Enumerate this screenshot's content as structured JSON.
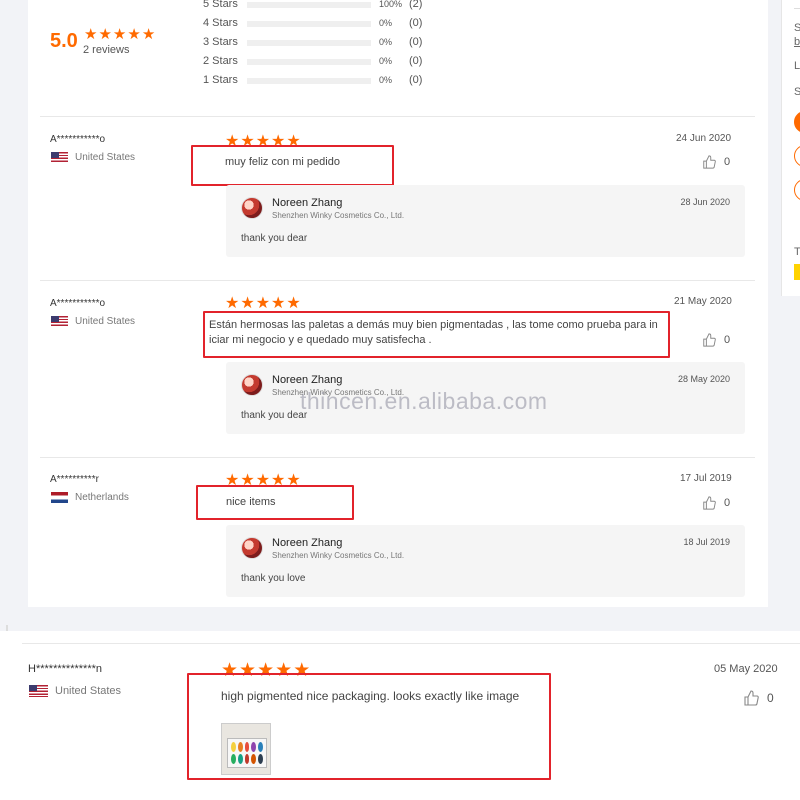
{
  "summary": {
    "score": "5.0",
    "reviews_label": "2 reviews",
    "distribution": [
      {
        "label": "5 Stars",
        "percent": "100%",
        "count": "(2)",
        "fill": 1.0
      },
      {
        "label": "4 Stars",
        "percent": "0%",
        "count": "(0)",
        "fill": 0
      },
      {
        "label": "3 Stars",
        "percent": "0%",
        "count": "(0)",
        "fill": 0
      },
      {
        "label": "2 Stars",
        "percent": "0%",
        "count": "(0)",
        "fill": 0
      },
      {
        "label": "1 Stars",
        "percent": "0%",
        "count": "(0)",
        "fill": 0
      }
    ]
  },
  "reviews": [
    {
      "name": "A***********o",
      "country": "United States",
      "rating": 5,
      "text": "muy feliz con mi pedido",
      "date": "24 Jun 2020",
      "likes": "0",
      "reply": {
        "name": "Noreen Zhang",
        "company": "Shenzhen Winky Cosmetics Co., Ltd.",
        "date": "28 Jun 2020",
        "text": "thank you dear"
      }
    },
    {
      "name": "A***********o",
      "country": "United States",
      "rating": 5,
      "text_line1": "Están hermosas las paletas a demás muy bien pigmentadas , las tome como prueba para in",
      "text_line2": "iciar mi negocio y e quedado muy satisfecha .",
      "date": "21 May 2020",
      "likes": "0",
      "reply": {
        "name": "Noreen Zhang",
        "company": "Shenzhen Winky Cosmetics Co., Ltd.",
        "date": "28 May 2020",
        "text": "thank you dear"
      }
    },
    {
      "name": "A**********r",
      "country": "Netherlands",
      "rating": 5,
      "text": "nice items",
      "date": "17 Jul 2019",
      "likes": "0",
      "reply": {
        "name": "Noreen Zhang",
        "company": "Shenzhen Winky Cosmetics Co., Ltd.",
        "date": "18 Jul 2019",
        "text": "thank you love"
      }
    },
    {
      "name": "H**************n",
      "country": "United States",
      "rating": 5,
      "text": "high pigmented nice packaging. looks exactly like image",
      "date": "05 May 2020",
      "likes": "0"
    }
  ],
  "right_column": {
    "items": [
      "S",
      "b",
      "L",
      "S",
      "T"
    ]
  },
  "watermark": "thincen.en.alibaba.com",
  "colors": {
    "accent": "#ff6a00",
    "highlight_box": "#e2232b"
  }
}
